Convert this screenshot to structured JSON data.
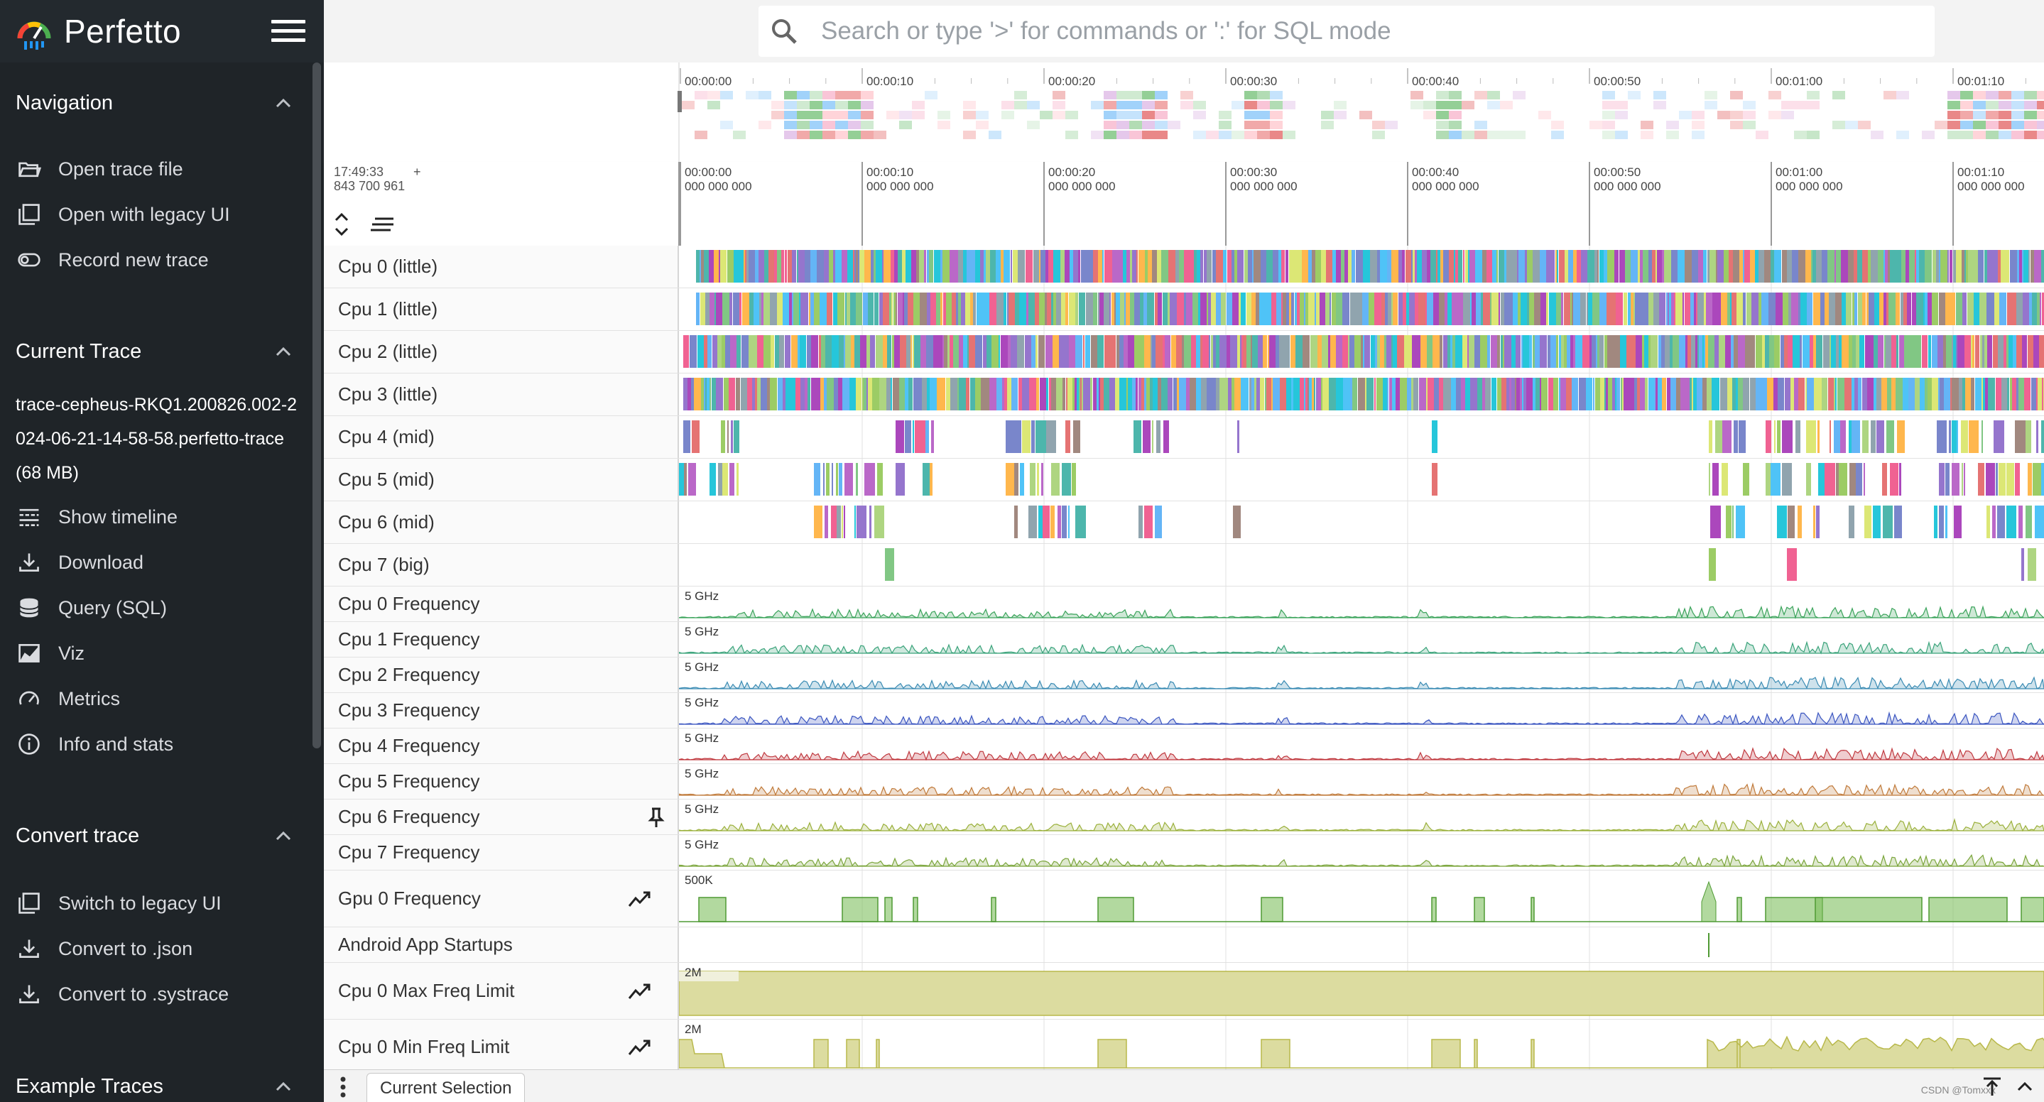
{
  "app": {
    "name": "Perfetto"
  },
  "search": {
    "placeholder": "Search or type '>' for commands or ':' for SQL mode"
  },
  "sidebar": {
    "sections": [
      {
        "title": "Navigation",
        "items": [
          {
            "label": "Open trace file",
            "icon": "folder-open-icon"
          },
          {
            "label": "Open with legacy UI",
            "icon": "window-icon"
          },
          {
            "label": "Record new trace",
            "icon": "record-icon"
          }
        ]
      },
      {
        "title": "Current Trace",
        "trace_name": "trace-cepheus-RKQ1.200826.002-2024-06-21-14-58-58.perfetto-trace (68 MB)",
        "items": [
          {
            "label": "Show timeline",
            "icon": "timeline-icon"
          },
          {
            "label": "Download",
            "icon": "download-icon"
          },
          {
            "label": "Query (SQL)",
            "icon": "database-icon"
          },
          {
            "label": "Viz",
            "icon": "chart-icon"
          },
          {
            "label": "Metrics",
            "icon": "speed-icon"
          },
          {
            "label": "Info and stats",
            "icon": "info-icon"
          }
        ]
      },
      {
        "title": "Convert trace",
        "items": [
          {
            "label": "Switch to legacy UI",
            "icon": "window-icon"
          },
          {
            "label": "Convert to .json",
            "icon": "download-icon"
          },
          {
            "label": "Convert to .systrace",
            "icon": "download-icon"
          }
        ]
      },
      {
        "title": "Example Traces",
        "items": []
      }
    ]
  },
  "timeline": {
    "origin_time": "17:49:33",
    "origin_ns": "843 700 961",
    "overview_ticks": [
      "00:00:00",
      "00:00:10",
      "00:00:20",
      "00:00:30",
      "00:00:40",
      "00:00:50",
      "00:01:00",
      "00:01:10"
    ],
    "axis_ticks": [
      {
        "time": "00:00:00",
        "ns": "000 000 000"
      },
      {
        "time": "00:00:10",
        "ns": "000 000 000"
      },
      {
        "time": "00:00:20",
        "ns": "000 000 000"
      },
      {
        "time": "00:00:30",
        "ns": "000 000 000"
      },
      {
        "time": "00:00:40",
        "ns": "000 000 000"
      },
      {
        "time": "00:00:50",
        "ns": "000 000 000"
      },
      {
        "time": "00:01:00",
        "ns": "000 000 000"
      },
      {
        "time": "00:01:10",
        "ns": "000 000 000"
      }
    ]
  },
  "tracks": [
    {
      "label": "Cpu 0 (little)",
      "kind": "cpu",
      "activity": "dense"
    },
    {
      "label": "Cpu 1 (little)",
      "kind": "cpu",
      "activity": "dense"
    },
    {
      "label": "Cpu 2 (little)",
      "kind": "cpu",
      "activity": "dense"
    },
    {
      "label": "Cpu 3 (little)",
      "kind": "cpu",
      "activity": "dense"
    },
    {
      "label": "Cpu 4 (mid)",
      "kind": "cpu",
      "activity": "sparse"
    },
    {
      "label": "Cpu 5 (mid)",
      "kind": "cpu",
      "activity": "sparse"
    },
    {
      "label": "Cpu 6 (mid)",
      "kind": "cpu",
      "activity": "sparse"
    },
    {
      "label": "Cpu 7 (big)",
      "kind": "cpu",
      "activity": "rare"
    },
    {
      "label": "Cpu 0 Frequency",
      "kind": "freq",
      "scale": "5 GHz",
      "color": "#3aa35a"
    },
    {
      "label": "Cpu 1 Frequency",
      "kind": "freq",
      "scale": "5 GHz",
      "color": "#3aa37a"
    },
    {
      "label": "Cpu 2 Frequency",
      "kind": "freq",
      "scale": "5 GHz",
      "color": "#3a8bb3"
    },
    {
      "label": "Cpu 3 Frequency",
      "kind": "freq",
      "scale": "5 GHz",
      "color": "#3a55c0"
    },
    {
      "label": "Cpu 4 Frequency",
      "kind": "freq",
      "scale": "5 GHz",
      "color": "#c0393f"
    },
    {
      "label": "Cpu 5 Frequency",
      "kind": "freq",
      "scale": "5 GHz",
      "color": "#c07a3a"
    },
    {
      "label": "Cpu 6 Frequency",
      "kind": "freq",
      "scale": "5 GHz",
      "color": "#9ab03a",
      "pinned": true
    },
    {
      "label": "Cpu 7 Frequency",
      "kind": "freq",
      "scale": "5 GHz",
      "color": "#7aa53a"
    },
    {
      "label": "Gpu 0 Frequency",
      "kind": "counter",
      "scale": "500K",
      "color": "#7fbf5f"
    },
    {
      "label": "Android App Startups",
      "kind": "startups"
    },
    {
      "label": "Cpu 0 Max Freq Limit",
      "kind": "limit-max",
      "scale": "2M",
      "color": "#b8b84a"
    },
    {
      "label": "Cpu 0 Min Freq Limit",
      "kind": "limit-min",
      "scale": "2M",
      "color": "#b8b84a"
    }
  ],
  "bottom": {
    "tab_label": "Current Selection",
    "watermark": "CSDN @Tomxxx"
  }
}
